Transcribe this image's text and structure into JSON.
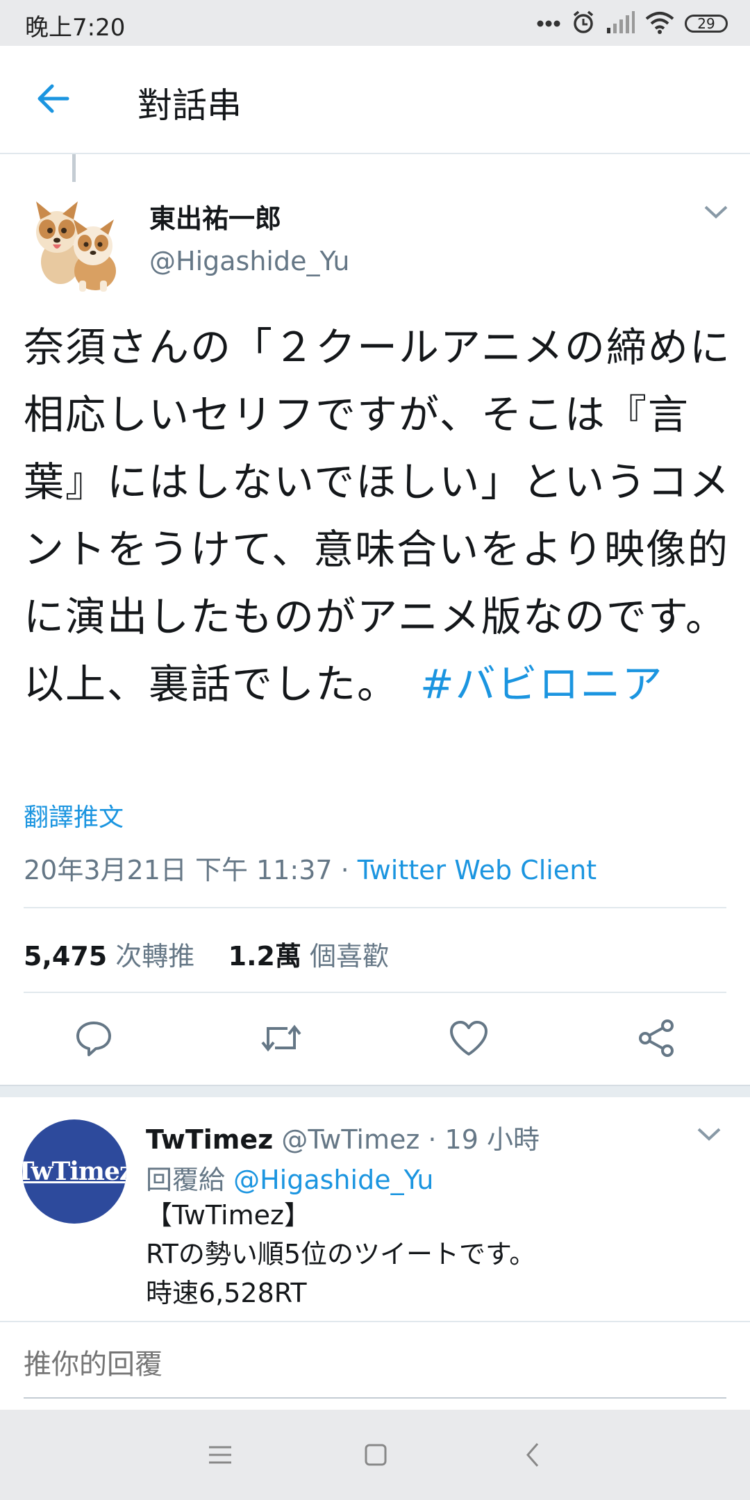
{
  "status_bar": {
    "time": "晚上7:20",
    "battery": "29",
    "icons": [
      "more-dots-icon",
      "alarm-icon",
      "signal-icon",
      "wifi-icon",
      "battery-icon"
    ]
  },
  "header": {
    "title": "對話串",
    "back_icon": "back-arrow-icon"
  },
  "tweet": {
    "display_name": "東出祐一郎",
    "handle": "@Higashide_Yu",
    "text": "奈須さんの「２クールアニメの締めに相応しいセリフですが、そこは『言葉』にはしないでほしい」というコメントをうけて、意味合いをより映像的に演出したものがアニメ版なのです。以上、裏話でした。　",
    "hashtag": "#バビロニア",
    "translate_label": "翻譯推文",
    "timestamp": "20年3月21日 下午 11:37 · ",
    "client": "Twitter Web Client",
    "retweet_count": "5,475",
    "retweet_label": " 次轉推",
    "like_count": "1.2萬",
    "like_label": " 個喜歡",
    "actions": [
      "reply-icon",
      "retweet-icon",
      "like-icon",
      "share-icon"
    ]
  },
  "reply": {
    "avatar_text": "TwTimez",
    "display_name": "TwTimez",
    "handle_time": " @TwTimez · 19 小時",
    "reply_to_label": "回覆給 ",
    "reply_to_handle": "@Higashide_Yu",
    "lines": [
      "【TwTimez】",
      "RTの勢い順5位のツイートです。",
      "時速6,528RT"
    ]
  },
  "composer": {
    "placeholder": "推你的回覆"
  },
  "accent_color": "#1b95e0"
}
